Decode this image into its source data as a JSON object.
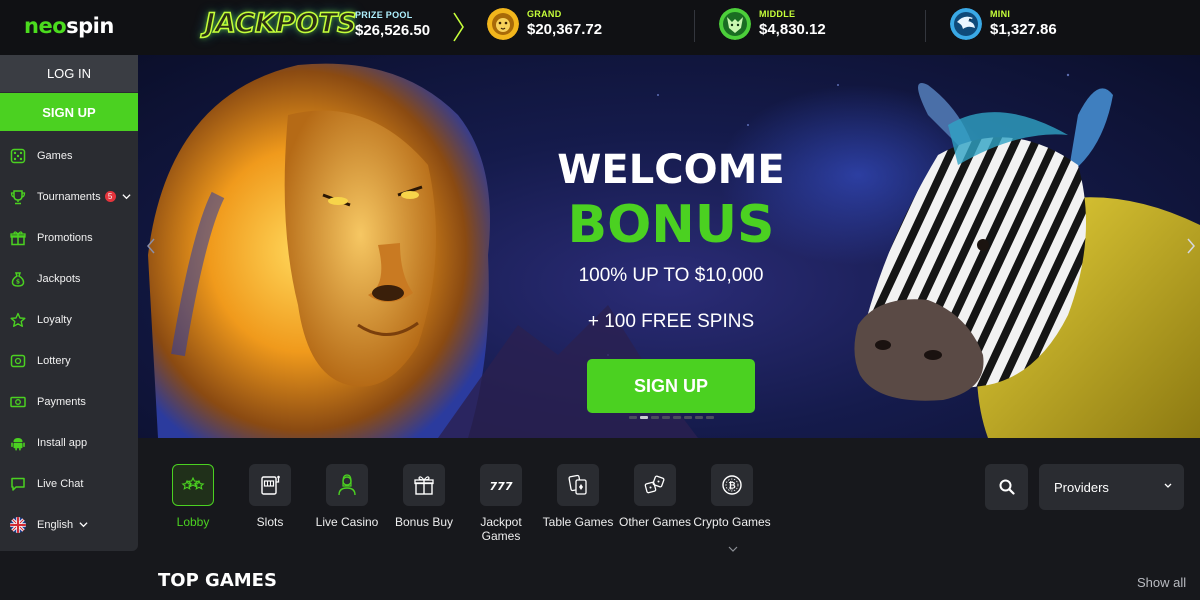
{
  "brand": {
    "part1": "neo",
    "part2": "spin"
  },
  "jackpots": {
    "title": "JACKPOTS",
    "prize_pool_label": "PRIZE POOL",
    "prize_pool_value": "$26,526.50",
    "tiers": [
      {
        "label": "GRAND",
        "value": "$20,367.72"
      },
      {
        "label": "MIDDLE",
        "value": "$4,830.12"
      },
      {
        "label": "MINI",
        "value": "$1,327.86"
      }
    ]
  },
  "sidebar": {
    "login": "LOG IN",
    "signup": "SIGN UP",
    "items": [
      {
        "label": "Games",
        "icon": "dice-icon"
      },
      {
        "label": "Tournaments",
        "icon": "trophy-icon",
        "badge": "5"
      },
      {
        "label": "Promotions",
        "icon": "gift-icon"
      },
      {
        "label": "Jackpots",
        "icon": "money-bag-icon"
      },
      {
        "label": "Loyalty",
        "icon": "star-icon"
      },
      {
        "label": "Lottery",
        "icon": "lottery-ticket-icon"
      },
      {
        "label": "Payments",
        "icon": "cash-icon"
      },
      {
        "label": "Install app",
        "icon": "android-icon"
      },
      {
        "label": "Live Chat",
        "icon": "chat-icon"
      },
      {
        "label": "English",
        "icon": "uk-flag-icon"
      }
    ]
  },
  "banner": {
    "line1": "WELCOME",
    "line2": "BONUS",
    "offer": "100% UP TO $10,000",
    "spins": "+ 100 FREE SPINS",
    "cta": "SIGN UP",
    "slides": 8,
    "active_slide": 1
  },
  "categories": [
    {
      "label": "Lobby",
      "icon": "stars-icon",
      "active": true
    },
    {
      "label": "Slots",
      "icon": "slot-machine-icon"
    },
    {
      "label": "Live Casino",
      "icon": "dealer-icon"
    },
    {
      "label": "Bonus Buy",
      "icon": "gift-box-icon"
    },
    {
      "label": "Jackpot Games",
      "icon": "triple-seven-icon"
    },
    {
      "label": "Table Games",
      "icon": "playing-cards-icon"
    },
    {
      "label": "Other Games",
      "icon": "dice-pair-icon"
    },
    {
      "label": "Crypto Games",
      "icon": "bitcoin-icon"
    }
  ],
  "search": {
    "icon": "search-icon"
  },
  "providers": {
    "label": "Providers"
  },
  "section": {
    "title": "TOP GAMES",
    "show_all": "Show all"
  },
  "colors": {
    "accent": "#4bd121",
    "sidebar": "#2a2c31",
    "background": "#17181c",
    "badge": "#e5343c"
  }
}
